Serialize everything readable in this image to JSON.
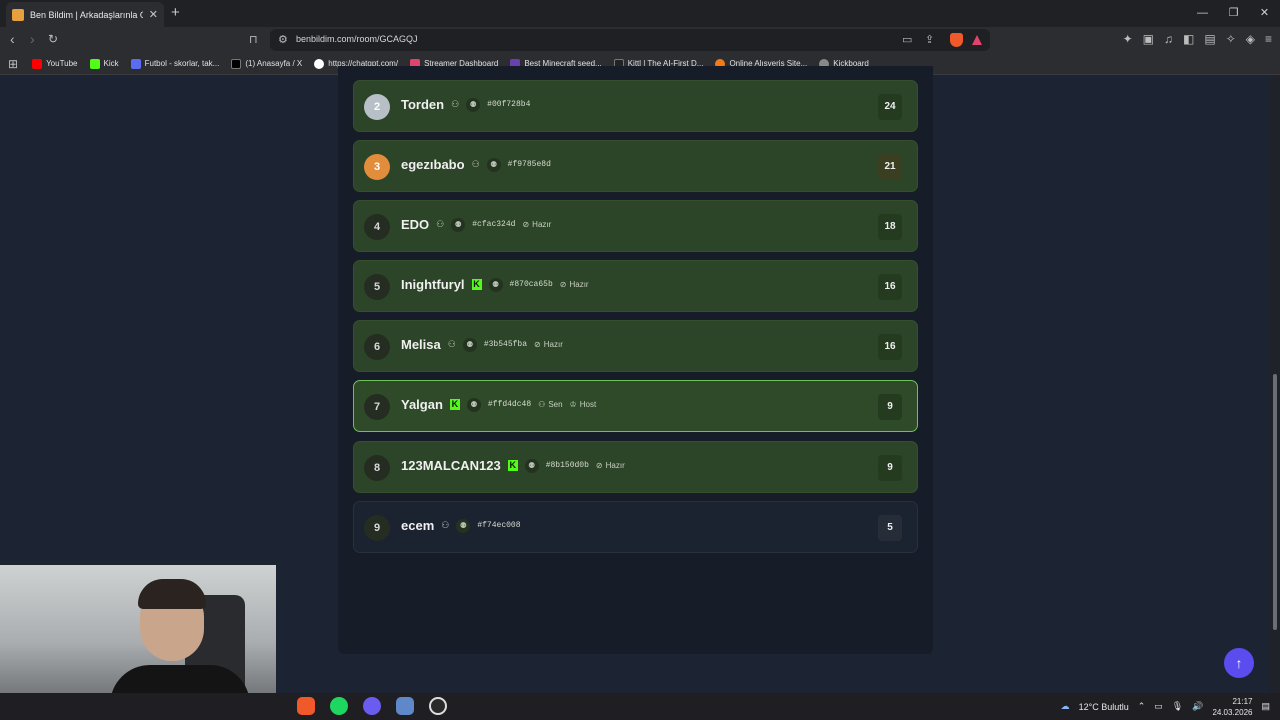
{
  "browser": {
    "tab_title": "Ben Bildim | Arkadaşlarınla Online",
    "url": "benbildim.com/room/GCAGQJ",
    "bookmarks": [
      {
        "label": "YouTube",
        "color": "#ff0000"
      },
      {
        "label": "Kick",
        "color": "#53fc18"
      },
      {
        "label": "Futbol - skorlar, tak...",
        "color": "#5a6cf0"
      },
      {
        "label": "(1) Anasayfa / X",
        "color": "#000000"
      },
      {
        "label": "https://chatgpt.com/",
        "color": "#ffffff"
      },
      {
        "label": "Streamer Dashboard",
        "color": "#e0446c"
      },
      {
        "label": "Best Minecraft seed...",
        "color": "#6a3fb0"
      },
      {
        "label": "Kittl | The AI-First D...",
        "color": "#222222"
      },
      {
        "label": "Online Alışveriş Site...",
        "color": "#f27a1a"
      },
      {
        "label": "Kickboard",
        "color": "#888888"
      }
    ]
  },
  "leaderboard": {
    "players": [
      {
        "rank": "2",
        "name": "Torden",
        "hash": "#00f728b4",
        "status": "",
        "score": "24",
        "medal": "silver",
        "kick": false,
        "me": false
      },
      {
        "rank": "3",
        "name": "egezıbabo",
        "hash": "#f9785e8d",
        "status": "",
        "score": "21",
        "medal": "bronze",
        "kick": false,
        "me": false
      },
      {
        "rank": "4",
        "name": "EDO",
        "hash": "#cfac324d",
        "status": "Hazır",
        "score": "18",
        "medal": "",
        "kick": false,
        "me": false
      },
      {
        "rank": "5",
        "name": "Inightfuryl",
        "hash": "#870ca65b",
        "status": "Hazır",
        "score": "16",
        "medal": "",
        "kick": true,
        "me": false
      },
      {
        "rank": "6",
        "name": "Melisa",
        "hash": "#3b545fba",
        "status": "Hazır",
        "score": "16",
        "medal": "",
        "kick": false,
        "me": false
      },
      {
        "rank": "7",
        "name": "Yalgan",
        "hash": "#ffd4dc48",
        "status": "",
        "score": "9",
        "medal": "",
        "kick": true,
        "me": true,
        "you_label": "Sen",
        "host_label": "Host"
      },
      {
        "rank": "8",
        "name": "123MALCAN123",
        "hash": "#8b150d0b",
        "status": "Hazır",
        "score": "9",
        "medal": "",
        "kick": true,
        "me": false
      },
      {
        "rank": "9",
        "name": "ecem",
        "hash": "#f74ec008",
        "status": "",
        "score": "5",
        "medal": "",
        "kick": false,
        "me": false,
        "plain": true
      }
    ]
  },
  "taskbar": {
    "weather": "12°C Bulutlu",
    "time": "21:17",
    "date": "24.03.2026"
  }
}
